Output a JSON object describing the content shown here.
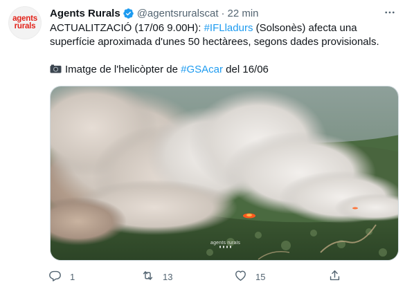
{
  "author": {
    "avatar_line1": "agents",
    "avatar_line2": "rurals",
    "name": "Agents Rurals",
    "handle": "@agentsruralscat",
    "separator": "·",
    "time": "22 min"
  },
  "tweet": {
    "line1_prefix": "ACTUALITZACIÓ (17/06 9.00H): ",
    "line1_hashtag": "#IFLladurs",
    "line1_suffix": " (Solsonès) afecta una",
    "line2": "superfície aproximada d'unes 50 hectàrees, segons dades provisionals.",
    "line3_prefix": "Imatge de l'helicòpter de ",
    "line3_hashtag": "#GSAcar",
    "line3_suffix": " del 16/06"
  },
  "media": {
    "watermark": "agents rurals"
  },
  "actions": {
    "replies": "1",
    "retweets": "13",
    "likes": "15"
  },
  "colors": {
    "link": "#1d9bf0",
    "secondary_text": "#536471",
    "verified": "#1d9bf0",
    "brand": "#e2231a"
  },
  "icons": [
    "verified-badge-icon",
    "more-icon",
    "camera-icon",
    "reply-icon",
    "retweet-icon",
    "like-icon",
    "share-icon"
  ]
}
